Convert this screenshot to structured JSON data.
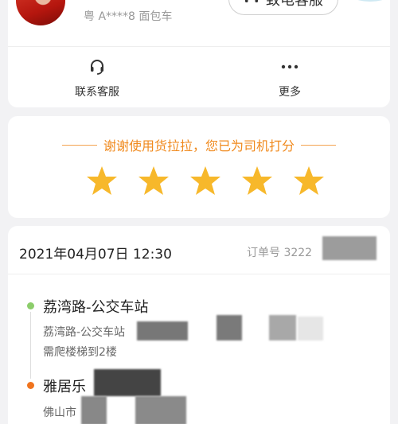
{
  "driver": {
    "plate": "粤 A****8 面包车",
    "call_label": "致电客服"
  },
  "actions": {
    "service_label": "联系客服",
    "more_label": "更多"
  },
  "rating": {
    "thanks_text": "谢谢使用货拉拉，您已为司机打分",
    "stars": 5,
    "star_color": "#f7b82b",
    "accent_color": "#f08a1e"
  },
  "order": {
    "datetime": "2021年04月07日 12:30",
    "order_no_prefix": "订单号 3222",
    "pickup": {
      "name": "荔湾路-公交车站",
      "address": "荔湾路-公交车站",
      "note": "需爬楼梯到2楼"
    },
    "dropoff": {
      "name": "雅居乐",
      "address": "佛山市"
    }
  }
}
